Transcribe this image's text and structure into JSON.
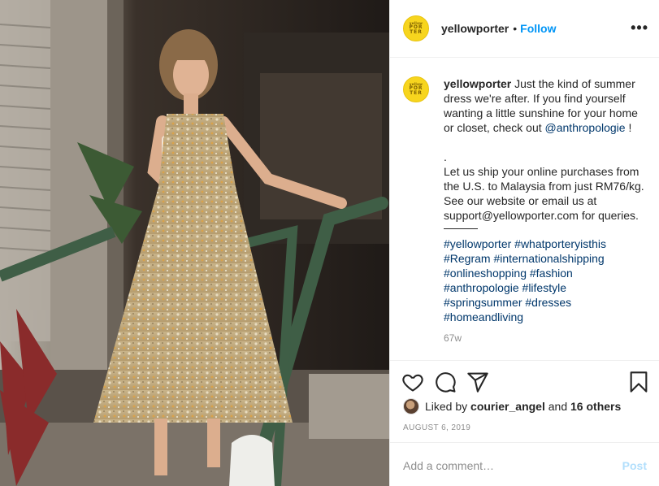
{
  "post": {
    "username": "yellowporter",
    "dot": "•",
    "follow_label": "Follow",
    "more_label": "•••",
    "avatar_logo": [
      "yellow",
      "POR",
      "TER"
    ]
  },
  "caption": {
    "username": "yellowporter",
    "text_1": "Just the kind of summer dress we're after. If you find yourself wanting a little sunshine for your home or closet, check out ",
    "mention": "@anthropologie",
    "text_2": " !",
    "spacer": ".",
    "text_3": "Let us ship your online purchases from the U.S. to Malaysia from just RM76/kg. See our website or email us at support@yellowporter.com for queries.",
    "hashtags": [
      "#yellowporter",
      "#whatporteryisthis",
      "#Regram",
      "#internationalshipping",
      "#onlineshopping",
      "#fashion",
      "#anthropologie",
      "#lifestyle",
      "#springsummer",
      "#dresses",
      "#homeandliving"
    ],
    "age": "67w"
  },
  "actions": {
    "like_icon": "heart-icon",
    "comment_icon": "comment-bubble-icon",
    "share_icon": "paper-plane-icon",
    "save_icon": "bookmark-icon"
  },
  "likes": {
    "prefix": "Liked by",
    "user": "courier_angel",
    "and": "and",
    "others": "16 others"
  },
  "date": "AUGUST 6, 2019",
  "add_comment": {
    "placeholder": "Add a comment…",
    "post_label": "Post"
  },
  "colors": {
    "link": "#00376b",
    "follow": "#0095f6",
    "post_disabled": "#b2dffc",
    "avatar_yellow": "#f7d51e"
  }
}
